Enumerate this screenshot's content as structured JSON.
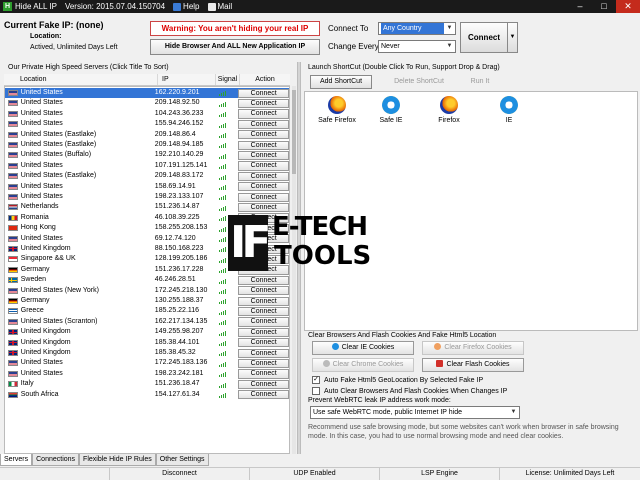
{
  "titlebar": {
    "app_name": "Hide ALL IP",
    "version": "Version: 2015.07.04.150704",
    "help": "Help",
    "mail": "Mail",
    "min": "–",
    "max": "□",
    "close": "✕"
  },
  "top": {
    "fake_ip": "Current Fake IP: (none)",
    "location_label": "Location:",
    "activation": "Actived, Unlimited Days Left",
    "warning": "Warning: You aren't hiding your real IP",
    "hide_button": "Hide Browser And ALL New Application IP",
    "connect_to_label": "Connect To",
    "connect_to_value": "Any Country",
    "change_every_label": "Change Every",
    "change_every_value": "Never",
    "connect_button": "Connect"
  },
  "servers": {
    "title": "Our Private High Speed Servers (Click Title To Sort)",
    "columns": [
      "Location",
      "IP",
      "Signal",
      "Action"
    ],
    "connect_label": "Connect",
    "rows": [
      {
        "country": "United States",
        "ip": "162.220.9.201",
        "flag": "us"
      },
      {
        "country": "United States",
        "ip": "209.148.92.50",
        "flag": "us"
      },
      {
        "country": "United States",
        "ip": "104.243.36.233",
        "flag": "us"
      },
      {
        "country": "United States",
        "ip": "155.94.246.152",
        "flag": "us"
      },
      {
        "country": "United States (Eastlake)",
        "ip": "209.148.86.4",
        "flag": "us"
      },
      {
        "country": "United States (Eastlake)",
        "ip": "209.148.94.185",
        "flag": "us"
      },
      {
        "country": "United States (Buffalo)",
        "ip": "192.210.140.29",
        "flag": "us"
      },
      {
        "country": "United States",
        "ip": "107.191.125.141",
        "flag": "us"
      },
      {
        "country": "United States (Eastlake)",
        "ip": "209.148.83.172",
        "flag": "us"
      },
      {
        "country": "United States",
        "ip": "158.69.14.91",
        "flag": "us"
      },
      {
        "country": "United States",
        "ip": "198.23.133.107",
        "flag": "us"
      },
      {
        "country": "Netherlands",
        "ip": "151.236.14.87",
        "flag": "nl"
      },
      {
        "country": "Romania",
        "ip": "46.108.39.225",
        "flag": "ro"
      },
      {
        "country": "Hong Kong",
        "ip": "158.255.208.153",
        "flag": "hk"
      },
      {
        "country": "United States",
        "ip": "69.12.74.120",
        "flag": "us"
      },
      {
        "country": "United Kingdom",
        "ip": "88.150.168.223",
        "flag": "uk"
      },
      {
        "country": "Singapore && UK",
        "ip": "128.199.205.186",
        "flag": "sg"
      },
      {
        "country": "Germany",
        "ip": "151.236.17.228",
        "flag": "de"
      },
      {
        "country": "Sweden",
        "ip": "46.246.28.51",
        "flag": "se"
      },
      {
        "country": "United States (New York)",
        "ip": "172.245.218.130",
        "flag": "us"
      },
      {
        "country": "Germany",
        "ip": "130.255.188.37",
        "flag": "de"
      },
      {
        "country": "Greece",
        "ip": "185.25.22.116",
        "flag": "gr"
      },
      {
        "country": "United States (Scranton)",
        "ip": "162.217.134.135",
        "flag": "us"
      },
      {
        "country": "United Kingdom",
        "ip": "149.255.98.207",
        "flag": "uk"
      },
      {
        "country": "United Kingdom",
        "ip": "185.38.44.101",
        "flag": "uk"
      },
      {
        "country": "United Kingdom",
        "ip": "185.38.45.32",
        "flag": "uk"
      },
      {
        "country": "United States",
        "ip": "172.245.183.136",
        "flag": "us"
      },
      {
        "country": "United States",
        "ip": "198.23.242.181",
        "flag": "us"
      },
      {
        "country": "Italy",
        "ip": "151.236.18.47",
        "flag": "it"
      },
      {
        "country": "South Africa",
        "ip": "154.127.61.34",
        "flag": "za"
      }
    ]
  },
  "launch": {
    "title": "Launch ShortCut (Double Click To Run, Support Drop & Drag)",
    "add": "Add ShortCut",
    "delete": "Delete ShortCut",
    "run": "Run It",
    "shortcuts": [
      {
        "label": "Safe Firefox",
        "icon": "firefox-icon"
      },
      {
        "label": "Safe IE",
        "icon": "ie-icon"
      },
      {
        "label": "Firefox",
        "icon": "firefox-icon"
      },
      {
        "label": "IE",
        "icon": "ie-icon"
      }
    ]
  },
  "watermark": {
    "letters": "IF",
    "line1": "E-TECH",
    "line2": "TOOLS"
  },
  "clear": {
    "title": "Clear Browsers And Flash Cookies And Fake Html5 Location",
    "ie": "Clear IE Cookies",
    "firefox": "Clear Firefox Cookies",
    "chrome": "Clear Chrome Cookies",
    "flash": "Clear Flash Cookies",
    "html5_chk": "Auto Fake Html5 GeoLocation By Selected Fake IP",
    "auto_clear_chk": "Auto Clear Browsers And Flash Cookies When Changes IP",
    "webrtc_label": "Prevent WebRTC leak IP address work mode:",
    "webrtc_value": "Use safe WebRTC mode, public Internet IP hide",
    "note": "Recommend use safe browsing mode, but some websites can't work when browser in safe browsing mode. In this case, you had to use normal browsing mode and need clear cookies."
  },
  "tabs": [
    "Servers",
    "Connections",
    "Flexible Hide IP Rules",
    "Other Settings"
  ],
  "status": {
    "s1": "Disconnect",
    "s2": "UDP Enabled",
    "s3": "LSP Engine",
    "s4": "License: Unlimited Days Left"
  },
  "colors": {
    "selection": "#3375d6",
    "warning": "#dd0000",
    "signal": "#2ea32e"
  }
}
